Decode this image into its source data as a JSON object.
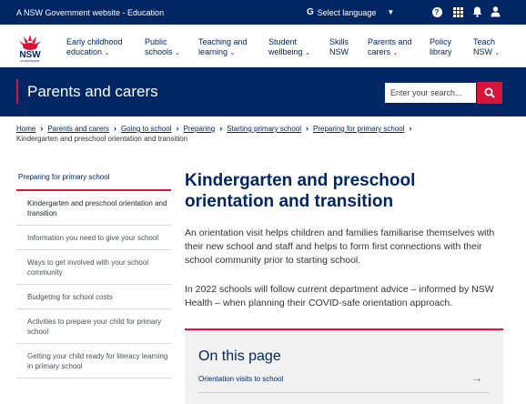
{
  "masthead": {
    "site_note": "A NSW Government website - Education",
    "language_label": "Select language"
  },
  "logo": {
    "text": "NSW",
    "sub": "GOVERNMENT"
  },
  "nav": [
    {
      "line1": "Early childhood",
      "line2": "education"
    },
    {
      "line1": "Public",
      "line2": "schools"
    },
    {
      "line1": "Teaching and",
      "line2": "learning"
    },
    {
      "line1": "Student",
      "line2": "wellbeing"
    },
    {
      "line1": "Skills",
      "line2": "NSW"
    },
    {
      "line1": "Parents and",
      "line2": "carers"
    },
    {
      "line1": "Policy",
      "line2": "library"
    },
    {
      "line1": "Teach",
      "line2": "NSW"
    }
  ],
  "banner": {
    "title": "Parents and carers",
    "search_placeholder": "Enter your search..."
  },
  "breadcrumb": {
    "items": [
      "Home",
      "Parents and carers",
      "Going to school",
      "Preparing",
      "Starting primary school",
      "Preparing for primary school"
    ],
    "current": "Kindergarten and preschool orientation and transition"
  },
  "sidebar": {
    "heading": "Preparing for primary school",
    "items": [
      "Kindergarten and preschool orientation and transition",
      "Information you need to give your school",
      "Ways to get involved with your school community",
      "Budgeting for school costs",
      "Activities to prepare your child for primary school",
      "Getting your child ready for literacy learning in primary school"
    ]
  },
  "main": {
    "title": "Kindergarten and preschool orientation and transition",
    "paragraph1": "An orientation visit helps children and families familiarise themselves with their new school and staff and helps to form first connections with their school community prior to starting school.",
    "paragraph2": "In 2022 schools will follow current department advice – informed by NSW Health – when planning their COVID-safe orientation approach.",
    "on_this_page": {
      "heading": "On this page",
      "links": [
        "Orientation visits to school"
      ]
    }
  },
  "colors": {
    "navy": "#002664",
    "red": "#d7153a"
  }
}
